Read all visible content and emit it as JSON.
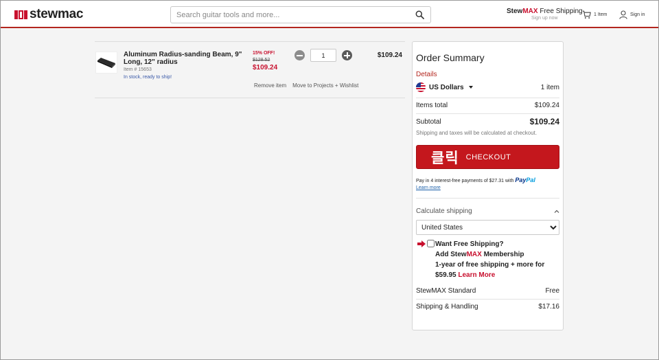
{
  "header": {
    "logo_text": "stewmac",
    "search_placeholder": "Search guitar tools and more...",
    "stewmax_prefix": "Stew",
    "stewmax_max": "MAX",
    "stewmax_suffix": " Free Shipping",
    "stewmax_signup": "Sign up now",
    "cart_label": "1 Item",
    "signin_label": "Sign in"
  },
  "cart": {
    "items": [
      {
        "title": "Aluminum Radius-sanding Beam, 9\" Long, 12\" radius",
        "item_number": "Item # 15653",
        "stock": "In stock, ready to ship!",
        "discount": "15% OFF!",
        "original_price": "$128.52",
        "sale_price": "$109.24",
        "quantity": "1",
        "line_total": "$109.24",
        "remove_label": "Remove item",
        "move_label": "Move to Projects + Wishlist"
      }
    ]
  },
  "summary": {
    "title": "Order Summary",
    "details_label": "Details",
    "currency": "US Dollars",
    "items_count": "1 item",
    "items_total_label": "Items total",
    "items_total_value": "$109.24",
    "subtotal_label": "Subtotal",
    "subtotal_value": "$109.24",
    "shipping_note": "Shipping and taxes will be calculated at checkout.",
    "checkout_badge": "클릭",
    "checkout_label": "CHECKOUT",
    "paypal_text": "Pay in 4 interest-free payments of $27.31 with",
    "paypal_brand_1": "Pay",
    "paypal_brand_2": "Pal",
    "paypal_learn_more": "Learn more",
    "calc_shipping_label": "Calculate shipping",
    "country_selected": "United States",
    "promo_line1": "Want Free Shipping?",
    "promo_line2_prefix": "Add Stew",
    "promo_line2_max": "MAX",
    "promo_line2_suffix": " Membership",
    "promo_line3": "1-year of free shipping + more for",
    "promo_price": "$59.95",
    "promo_learn_more": "Learn More",
    "stewmax_standard_label": "StewMAX Standard",
    "stewmax_standard_value": "Free",
    "shipping_handling_label": "Shipping & Handling",
    "shipping_handling_value": "$17.16"
  },
  "colors": {
    "brand_red": "#c4171d",
    "link_blue": "#1a5ea8"
  }
}
